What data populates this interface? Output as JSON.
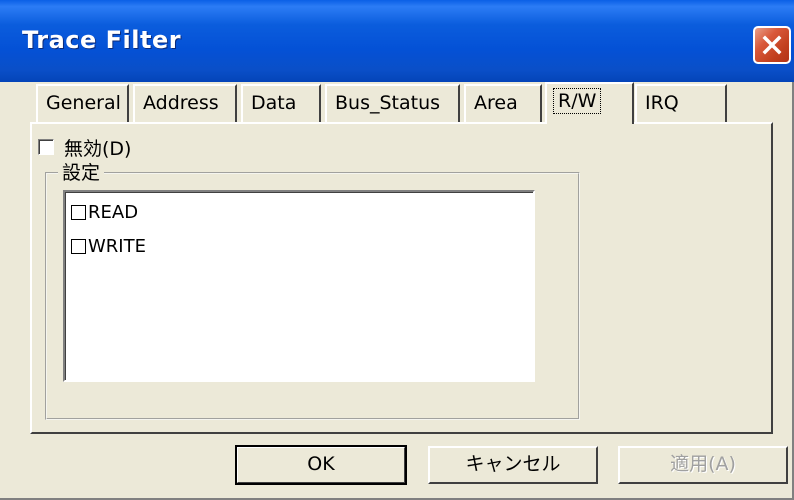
{
  "window": {
    "title": "Trace Filter"
  },
  "tabs": [
    {
      "label": "General"
    },
    {
      "label": "Address"
    },
    {
      "label": "Data"
    },
    {
      "label": "Bus_Status"
    },
    {
      "label": "Area"
    },
    {
      "label": "R/W",
      "active": true
    },
    {
      "label": "IRQ"
    }
  ],
  "disable": {
    "label": "無効(D)",
    "checked": false
  },
  "settings": {
    "group_label": "設定",
    "items": [
      {
        "label": "READ",
        "checked": false
      },
      {
        "label": "WRITE",
        "checked": false
      }
    ]
  },
  "buttons": {
    "ok": "OK",
    "cancel": "キャンセル",
    "apply": "適用(A)"
  },
  "icons": {
    "close": "close-icon"
  }
}
